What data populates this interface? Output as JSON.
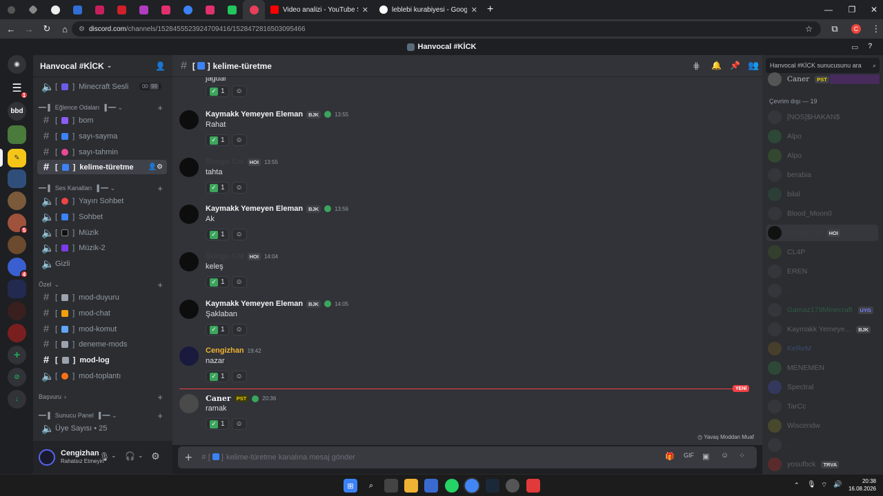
{
  "browser": {
    "tabs": [
      {
        "title": "Video analizi - YouTube Studio"
      },
      {
        "title": "leblebi kurabiyesi - Google'da Ara"
      }
    ],
    "new_tab": "+",
    "url_host": "discord.com",
    "url_path": "/channels/1528455523924709416/1528472816503095466"
  },
  "window_title": "Hanvocal #KİCK",
  "rail": {
    "bbd": "bbd",
    "badges": [
      "1",
      "5",
      "4"
    ]
  },
  "server": {
    "name": "Hanvocal #KİCK",
    "voice_top": {
      "label": "Minecraft Sesli",
      "count_a": "00",
      "count_b": "99"
    },
    "categories": {
      "fun": "Eğlence Odaları",
      "voice": "Ses Kanalları",
      "private": "Özel",
      "apply": "Başvuru",
      "panel": "Sunucu Panel"
    },
    "channels": {
      "bom": "bom",
      "sayi_sayma": "sayı-sayma",
      "sayi_tahmin": "sayı-tahmin",
      "kelime": "kelime-türetme",
      "yayin": "Yayın Sohbet",
      "sohbet": "Sohbet",
      "muzik": "Müzik",
      "muzik2": "Müzik-2",
      "gizli": "Gizli",
      "mod_duyuru": "mod-duyuru",
      "mod_chat": "mod-chat",
      "mod_komut": "mod-komut",
      "deneme": "deneme-mods",
      "mod_log": "mod-log",
      "mod_toplanti": "mod-toplantı",
      "uye": "Üye Sayısı • 25"
    }
  },
  "user": {
    "name": "Cengizhan",
    "status": "Rahatsız Etmeyin"
  },
  "chat": {
    "channel": "kelime-türetme",
    "first_partial": "jaguar",
    "messages": [
      {
        "author": "Kaymakk Yemeyen Eleman",
        "tag": "BJK",
        "time": "13:55",
        "text": "Rahat",
        "react": "1"
      },
      {
        "author": "Bongo Cat",
        "tag": "HOI",
        "time": "13:55",
        "text": "tahta",
        "react": "1"
      },
      {
        "author": "Kaymakk Yemeyen Eleman",
        "tag": "BJK",
        "time": "13:56",
        "text": "Ak",
        "react": "1"
      },
      {
        "author": "Bongo Cat",
        "tag": "HOI",
        "time": "14:04",
        "text": "keleş",
        "react": "1"
      },
      {
        "author": "Kaymakk Yemeyen Eleman",
        "tag": "BJK",
        "time": "14:05",
        "text": "Şaklaban",
        "react": "1"
      },
      {
        "author": "Cengizhan",
        "tag": "",
        "time": "19:42",
        "text": "nazar",
        "react": "1"
      },
      {
        "author": "Caner",
        "tag": "PST",
        "time": "20:36",
        "text": "ramak",
        "react": "1"
      }
    ],
    "new_label": "YENİ",
    "slowmode": "Yavaş Moddan Muaf",
    "composer_placeholder": "kelime-türetme kanalına mesaj gönder",
    "first_react": "1"
  },
  "members": {
    "search_placeholder": "Hanvocal #KİCK sunucusunu ara",
    "top_member": "Caner",
    "top_tag": "PST",
    "offline_header": "Çevrim dışı — 19",
    "list": [
      "[NOS]$HAKAN$",
      "Alpo",
      "Alpo",
      "berabia",
      "bilal",
      "Blood_Moon0",
      "Bongo Cat",
      "CL4P",
      "EREN",
      "...",
      "Gamaz179Minecraft",
      "Kaymakk Yemeye...",
      "KeReM",
      "MENEMEN",
      "Spectral",
      "TarCc",
      "Wiscendw",
      "...",
      "yosufbck"
    ],
    "tags": {
      "Bongo Cat": "HOI",
      "Gamaz179Minecraft": "UYG",
      "Kaymakk Yemeye...": "BJK",
      "yosufbck": "TRVA"
    }
  },
  "taskbar": {
    "time": "20:38",
    "date": "16.08.2026"
  }
}
